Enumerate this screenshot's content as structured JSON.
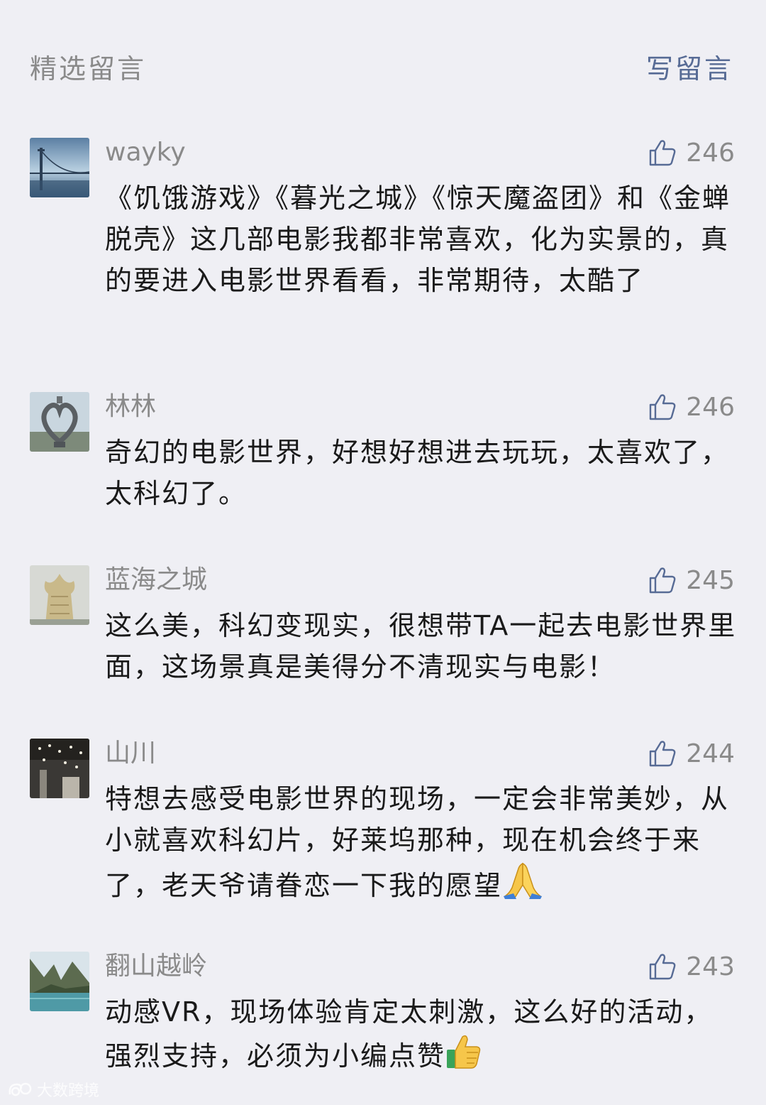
{
  "header": {
    "title": "精选留言",
    "write_label": "写留言"
  },
  "comments": [
    {
      "nickname": "wayky",
      "likes": "246",
      "avatar": "bridge-fog-photo",
      "content": "《饥饿游戏》《暮光之城》《惊天魔盗团》和《金蝉脱壳》这几部电影我都非常喜欢，化为实景的，真的要进入电影世界看看，非常期待，太酷了"
    },
    {
      "nickname": "林林",
      "likes": "246",
      "avatar": "heart-sculpture-photo",
      "content": "奇幻的电影世界，好想好想进去玩玩，太喜欢了，太科幻了。"
    },
    {
      "nickname": "蓝海之城",
      "likes": "245",
      "avatar": "lotus-tower-photo",
      "content": "这么美，科幻变现实，很想带TA一起去电影世界里面，这场景真是美得分不清现实与电影！"
    },
    {
      "nickname": "山川",
      "likes": "244",
      "avatar": "chandelier-photo",
      "content": "特想去感受电影世界的现场，一定会非常美妙，从小就喜欢科幻片，好莱坞那种，现在机会终于来了，老天爷请眷恋一下我的愿望",
      "emoji": "folded-hands-emoji"
    },
    {
      "nickname": "翻山越岭",
      "likes": "243",
      "avatar": "mountain-lake-photo",
      "content": "动感VR，现场体验肯定太刺激，这么好的活动，强烈支持，必须为小编点赞",
      "emoji": "thumbs-up-emoji"
    }
  ],
  "watermark": {
    "text": "大数跨境"
  },
  "colors": {
    "background": "#efeff4",
    "link": "#576b95",
    "meta": "#8a8a8a",
    "text": "#1a1a1a"
  }
}
